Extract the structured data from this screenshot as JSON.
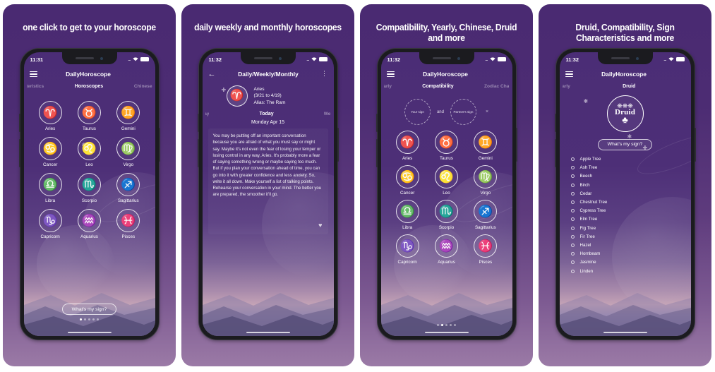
{
  "panels": [
    {
      "headline": "one click to get to your horoscope",
      "status": {
        "time": "11:31",
        "signal": "....",
        "wifi": "wifi-icon",
        "battery": "battery-icon"
      },
      "appbar": {
        "menu": "hamburger-icon",
        "title": "DailyHoroscope"
      },
      "tabs": {
        "left": "acteristics",
        "active": "Horoscopes",
        "right": "Chinese"
      },
      "zodiac": [
        {
          "name": "Aries",
          "glyph": "♈"
        },
        {
          "name": "Taurus",
          "glyph": "♉"
        },
        {
          "name": "Gemini",
          "glyph": "♊"
        },
        {
          "name": "Cancer",
          "glyph": "♋"
        },
        {
          "name": "Leo",
          "glyph": "♌"
        },
        {
          "name": "Virgo",
          "glyph": "♍"
        },
        {
          "name": "Libra",
          "glyph": "♎"
        },
        {
          "name": "Scorpio",
          "glyph": "♏"
        },
        {
          "name": "Sagittarius",
          "glyph": "♐"
        },
        {
          "name": "Capricorn",
          "glyph": "♑"
        },
        {
          "name": "Aquarius",
          "glyph": "♒"
        },
        {
          "name": "Pisces",
          "glyph": "♓"
        }
      ],
      "cta": "What's my sign?",
      "dots": 5,
      "active_dot": 0
    },
    {
      "headline": "daily weekly and monthly horoscopes",
      "status": {
        "time": "11:32",
        "signal": "....",
        "wifi": "wifi-icon",
        "battery": "battery-icon"
      },
      "appbar": {
        "back": "back-arrow-icon",
        "title": "Daily/Weekly/Monthly",
        "overflow": "kebab-menu-icon"
      },
      "sign": {
        "glyph": "♈",
        "name": "Aries",
        "dates": "(3/21 to 4/19)",
        "alias": "Alias: The Ram"
      },
      "tabs": {
        "left": "rday",
        "active": "Today",
        "right": "We"
      },
      "date": "Monday Apr 15",
      "body": "You may be putting off an important conversation because you are afraid of what you must say or might say. Maybe it's not even the fear of losing your temper or losing control in any way, Aries. It's probably more a fear of saying something wrong or maybe saying too much. But if you plan your conversation ahead of time, you can go into it with greater confidence and less anxiety. So, write it all down. Make yourself a list of talking points. Rehearse your conversation in your mind. The better you are prepared, the smoother it'll go.",
      "favorite": "heart-icon"
    },
    {
      "headline": "Compatibility, Yearly, Chinese, Druid and more",
      "status": {
        "time": "11:32",
        "signal": "....",
        "wifi": "wifi-icon",
        "battery": "battery-icon"
      },
      "appbar": {
        "menu": "hamburger-icon",
        "title": "DailyHoroscope"
      },
      "tabs": {
        "left": "Yearly",
        "active": "Compatibility",
        "right": "Zodiac Cha"
      },
      "compat": {
        "your_sign": "Your sign",
        "conjunction": "and",
        "partner_sign": "Partner's sign",
        "clear": "×"
      },
      "zodiac": [
        {
          "name": "Aries",
          "glyph": "♈"
        },
        {
          "name": "Taurus",
          "glyph": "♉"
        },
        {
          "name": "Gemini",
          "glyph": "♊"
        },
        {
          "name": "Cancer",
          "glyph": "♋"
        },
        {
          "name": "Leo",
          "glyph": "♌"
        },
        {
          "name": "Virgo",
          "glyph": "♍"
        },
        {
          "name": "Libra",
          "glyph": "♎"
        },
        {
          "name": "Scorpio",
          "glyph": "♏"
        },
        {
          "name": "Sagittarius",
          "glyph": "♐"
        },
        {
          "name": "Capricorn",
          "glyph": "♑"
        },
        {
          "name": "Aquarius",
          "glyph": "♒"
        },
        {
          "name": "Pisces",
          "glyph": "♓"
        }
      ],
      "dots": 5,
      "active_dot": 1
    },
    {
      "headline": "Druid, Compatibility, Sign Characteristics and more",
      "status": {
        "time": "11:32",
        "signal": "....",
        "wifi": "wifi-icon",
        "battery": "battery-icon"
      },
      "appbar": {
        "menu": "hamburger-icon",
        "title": "DailyHoroscope"
      },
      "tabs": {
        "left": "Yearly",
        "active": "Druid",
        "right": ""
      },
      "logo": {
        "word": "Druid",
        "tree": "tree-icon"
      },
      "cta": "What's my sign?",
      "trees": [
        "Apple Tree",
        "Ash Tree",
        "Beech",
        "Birch",
        "Cedar",
        "Chestnut Tree",
        "Cypress Tree",
        "Elm Tree",
        "Fig Tree",
        "Fir Tree",
        "Hazel",
        "Hornbeam",
        "Jasmine",
        "Linden"
      ]
    }
  ]
}
